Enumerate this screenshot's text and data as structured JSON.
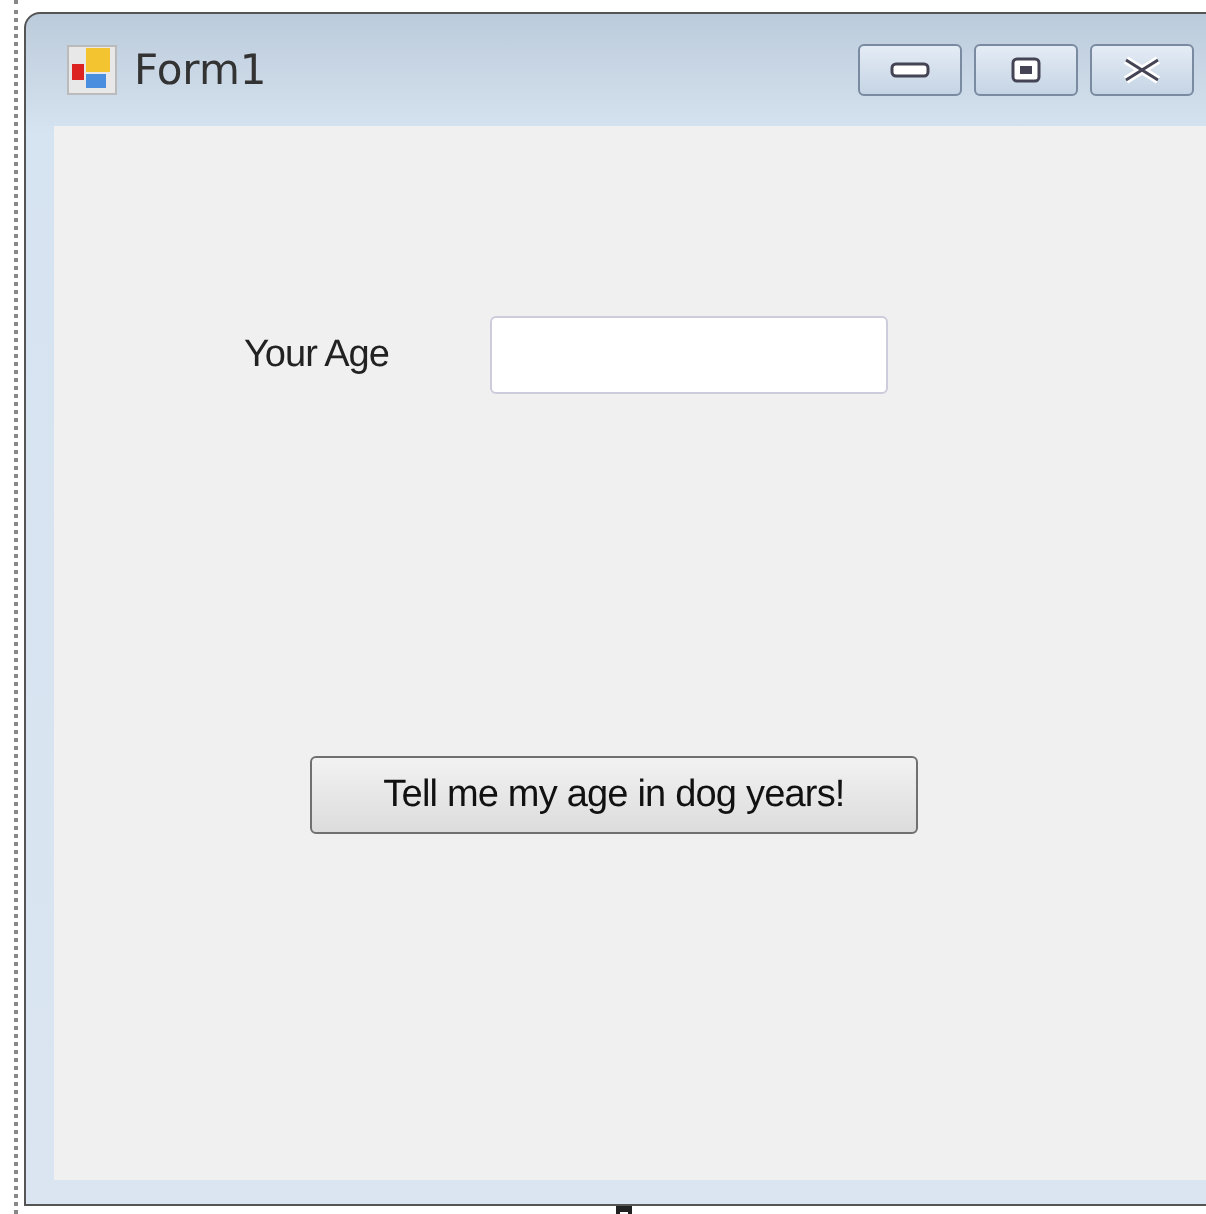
{
  "window": {
    "title": "Form1"
  },
  "form": {
    "label": "Your Age",
    "button": "Tell me my age in dog years!"
  }
}
